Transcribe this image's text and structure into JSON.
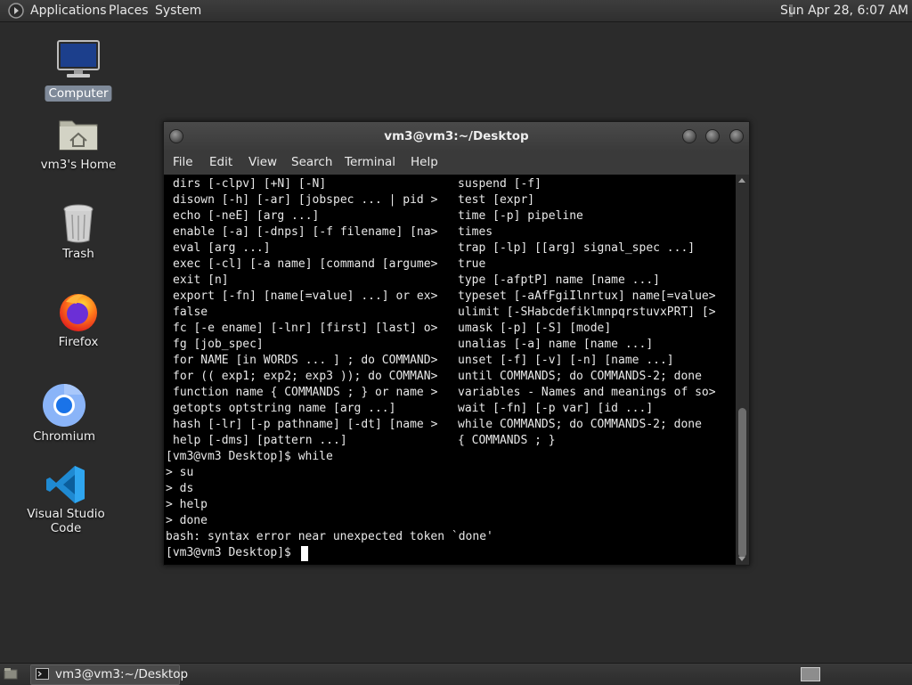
{
  "top_panel": {
    "menus": [
      "Applications",
      "Places",
      "System"
    ],
    "clock": "Sun Apr 28,  6:07 AM"
  },
  "desktop_icons": [
    {
      "label": "Computer",
      "icon": "computer-icon"
    },
    {
      "label": "vm3's Home",
      "icon": "home-folder-icon"
    },
    {
      "label": "Trash",
      "icon": "trash-icon"
    },
    {
      "label": "Firefox",
      "icon": "firefox-icon"
    },
    {
      "label": "Chromium",
      "icon": "chromium-icon"
    },
    {
      "label": "Visual Studio Code",
      "icon": "vscode-icon"
    }
  ],
  "terminal": {
    "title": "vm3@vm3:~/Desktop",
    "menu": [
      "File",
      "Edit",
      "View",
      "Search",
      "Terminal",
      "Help"
    ],
    "help_left": [
      "dirs [-clpv] [+N] [-N]",
      "disown [-h] [-ar] [jobspec ... | pid >",
      "echo [-neE] [arg ...]",
      "enable [-a] [-dnps] [-f filename] [na>",
      "eval [arg ...]",
      "exec [-cl] [-a name] [command [argume>",
      "exit [n]",
      "export [-fn] [name[=value] ...] or ex>",
      "false",
      "fc [-e ename] [-lnr] [first] [last] o>",
      "fg [job_spec]",
      "for NAME [in WORDS ... ] ; do COMMAND>",
      "for (( exp1; exp2; exp3 )); do COMMAN>",
      "function name { COMMANDS ; } or name >",
      "getopts optstring name [arg ...]",
      "hash [-lr] [-p pathname] [-dt] [name >",
      "help [-dms] [pattern ...]"
    ],
    "help_right": [
      "suspend [-f]",
      "test [expr]",
      "time [-p] pipeline",
      "times",
      "trap [-lp] [[arg] signal_spec ...]",
      "true",
      "type [-afptP] name [name ...]",
      "typeset [-aAfFgiIlnrtux] name[=value>",
      "ulimit [-SHabcdefiklmnpqrstuvxPRT] [>",
      "umask [-p] [-S] [mode]",
      "unalias [-a] name [name ...]",
      "unset [-f] [-v] [-n] [name ...]",
      "until COMMANDS; do COMMANDS-2; done",
      "variables - Names and meanings of so>",
      "wait [-fn] [-p var] [id ...]",
      "while COMMANDS; do COMMANDS-2; done",
      "{ COMMANDS ; }"
    ],
    "session": [
      "[vm3@vm3 Desktop]$ while",
      "> su",
      "> ds",
      "> help",
      "> done",
      "bash: syntax error near unexpected token `done'",
      "[vm3@vm3 Desktop]$ "
    ]
  },
  "taskbar": {
    "window_label": "vm3@vm3:~/Desktop"
  }
}
